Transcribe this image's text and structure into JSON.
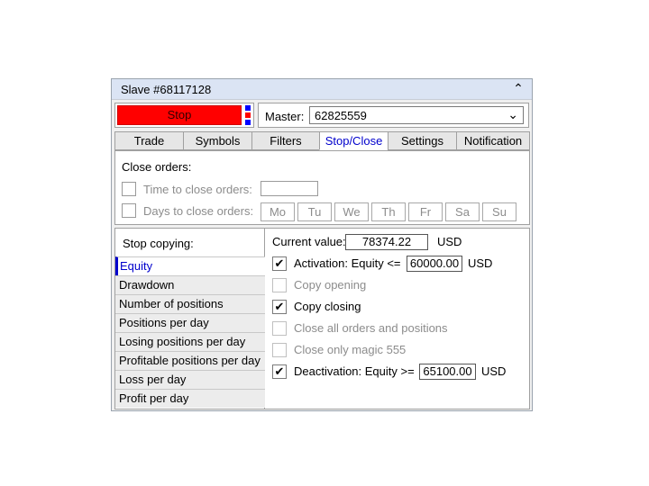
{
  "title": "Slave #68117128",
  "stop_label": "Stop",
  "master": {
    "label": "Master:",
    "value": "62825559"
  },
  "tabs": [
    "Trade",
    "Symbols",
    "Filters",
    "Stop/Close",
    "Settings",
    "Notification"
  ],
  "active_tab": "Stop/Close",
  "close_orders": {
    "header": "Close orders:",
    "time_label": "Time to close orders:",
    "time_value": "",
    "days_label": "Days to close orders:",
    "days": [
      "Mo",
      "Tu",
      "We",
      "Th",
      "Fr",
      "Sa",
      "Su"
    ]
  },
  "stop_copying": {
    "header": "Stop copying:",
    "items": [
      "Equity",
      "Drawdown",
      "Number of positions",
      "Positions per day",
      "Losing positions per day",
      "Profitable positions per day",
      "Loss per day",
      "Profit per day"
    ],
    "selected": "Equity"
  },
  "equity": {
    "current_label": "Current value:",
    "current_value": "78374.22",
    "currency": "USD",
    "activation_label": "Activation: Equity <=",
    "activation_value": "60000.00",
    "activation_checked": true,
    "copy_opening_label": "Copy opening",
    "copy_opening_checked": false,
    "copy_closing_label": "Copy closing",
    "copy_closing_checked": true,
    "close_all_label": "Close all orders and positions",
    "close_all_checked": false,
    "close_magic_label": "Close only magic 555",
    "close_magic_checked": false,
    "deactivation_label": "Deactivation: Equity >=",
    "deactivation_value": "65100.00",
    "deactivation_checked": true
  },
  "colors": {
    "stop_button": "#ff0000",
    "active_tab_text": "#0000cc",
    "title_bar": "#dbe4f4"
  }
}
